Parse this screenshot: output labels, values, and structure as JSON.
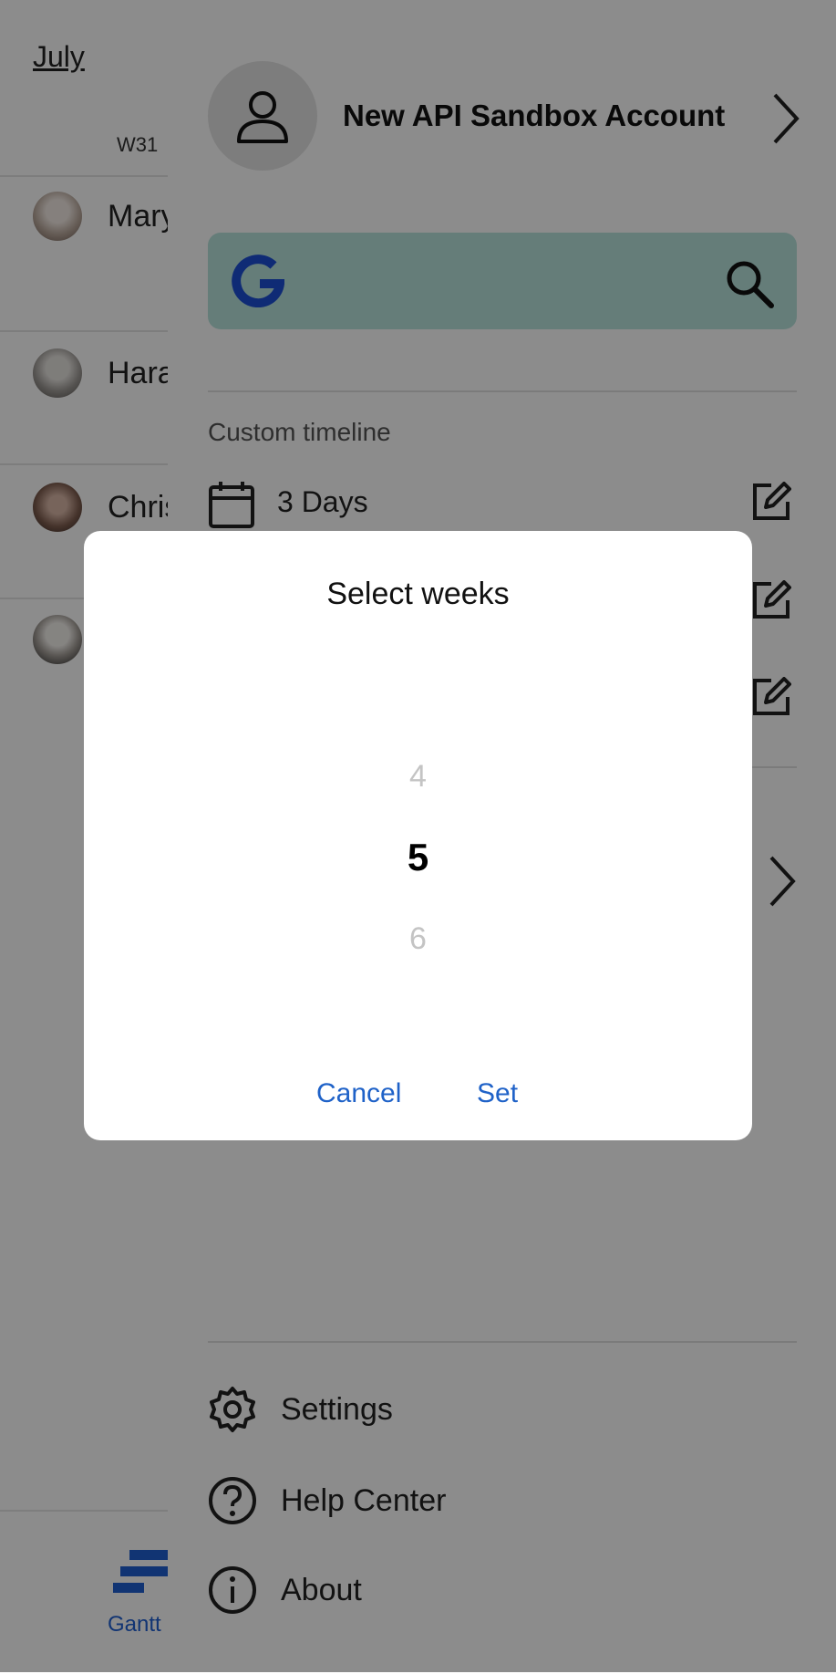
{
  "background_app": {
    "month": "July",
    "week": "W31",
    "people": [
      "Mary",
      "Hara",
      "Chris",
      ""
    ],
    "bottom_nav": {
      "gantt_label": "Gantt"
    }
  },
  "drawer": {
    "account_name": "New API Sandbox Account",
    "search": {
      "value": ""
    },
    "custom_timeline_label": "Custom timeline",
    "timelines": [
      {
        "label": "3 Days"
      }
    ],
    "menu": [
      {
        "label": "Settings",
        "icon": "gear-icon"
      },
      {
        "label": "Help Center",
        "icon": "help-circle-icon"
      },
      {
        "label": "About",
        "icon": "info-icon"
      }
    ]
  },
  "dialog": {
    "title": "Select weeks",
    "picker": {
      "previous": "4",
      "selected": "5",
      "next": "6"
    },
    "cancel_label": "Cancel",
    "set_label": "Set"
  },
  "colors": {
    "accent": "#1f62c8",
    "search_bg": "#b9e3dd",
    "scrim": "rgba(0,0,0,0.45)"
  }
}
